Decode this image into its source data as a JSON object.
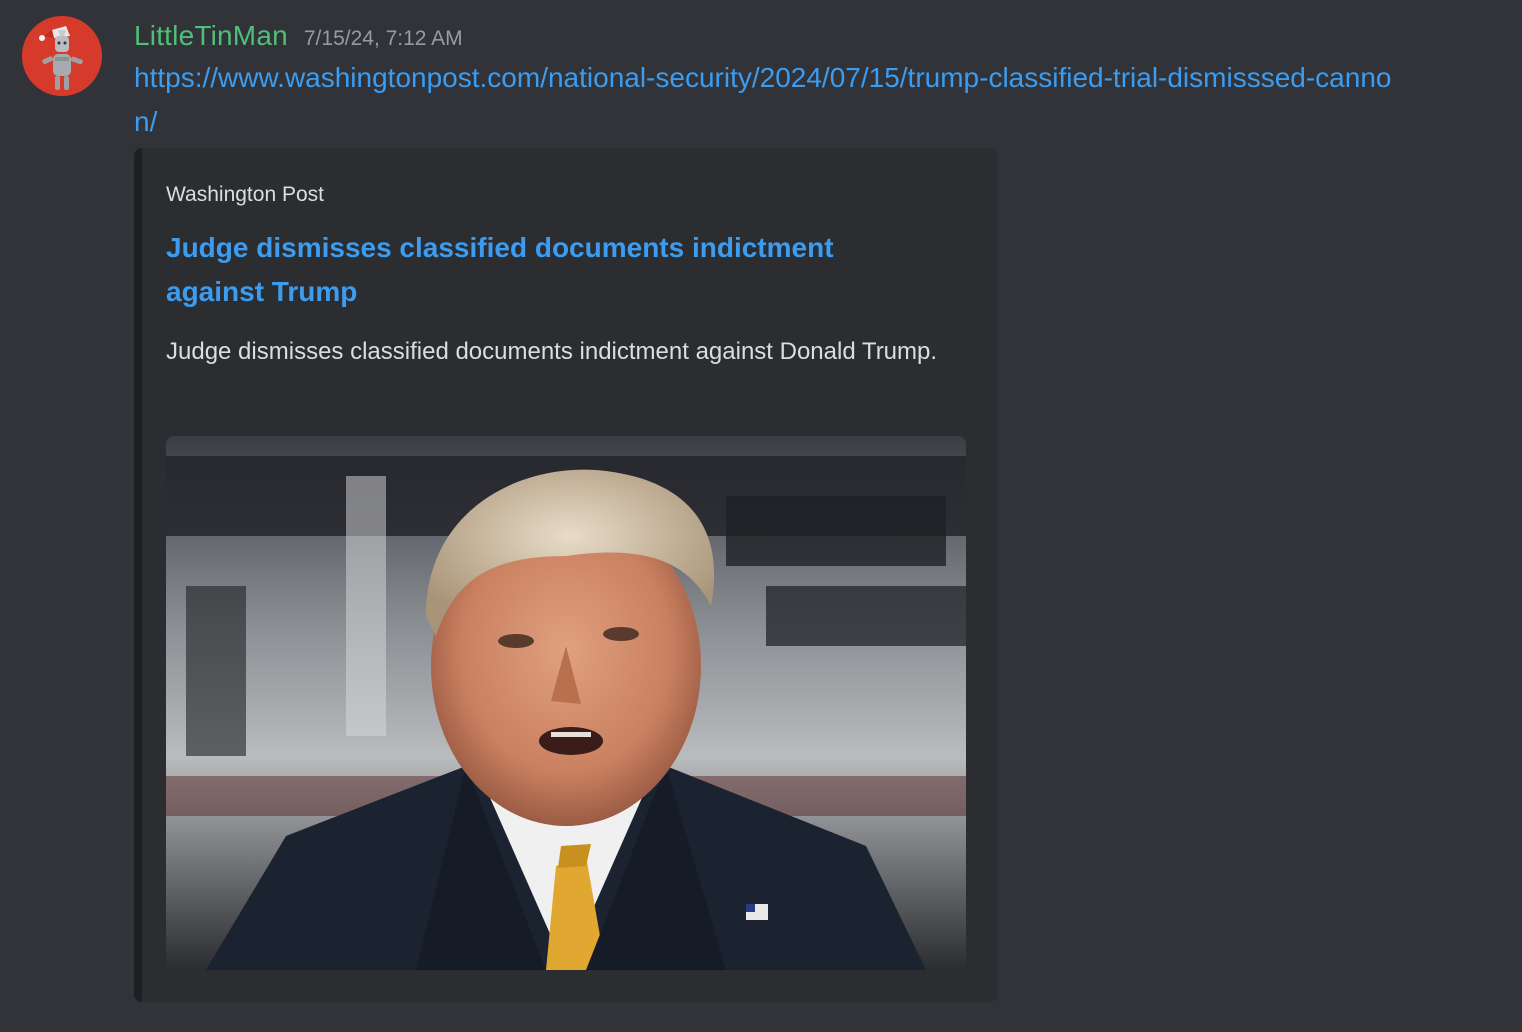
{
  "message": {
    "author": "LittleTinMan",
    "timestamp": "7/15/24, 7:12 AM",
    "link_text": "https://www.washingtonpost.com/national-security/2024/07/15/trump-classified-trial-dismisssed-cannon/"
  },
  "embed": {
    "provider": "Washington Post",
    "title": "Judge dismisses classified documents indictment against Trump",
    "description": "Judge dismisses classified documents indictment against Donald Trump."
  },
  "colors": {
    "background": "#313338",
    "embed_background": "#2b2d31",
    "username": "#4fbf7a",
    "link": "#3b9cf0",
    "timestamp": "#949ba4",
    "text": "#dbdee1",
    "avatar_background": "#d63a2a"
  },
  "icons": {
    "avatar": "tin-man-robot-avatar"
  }
}
